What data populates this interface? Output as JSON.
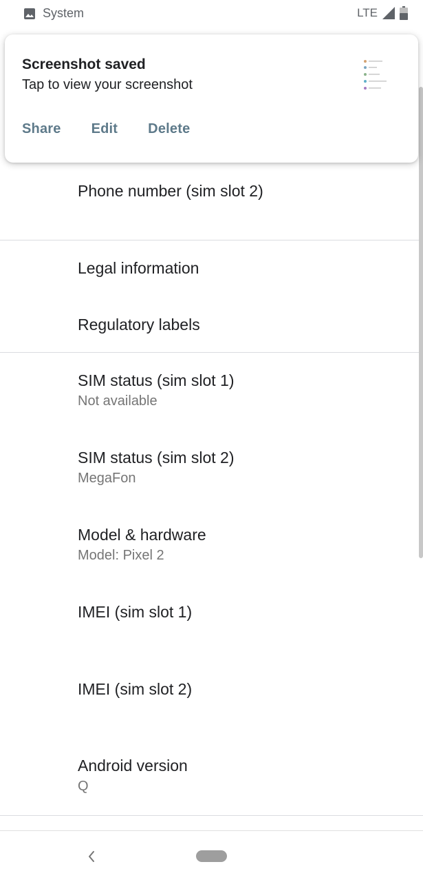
{
  "status_bar": {
    "app_name": "System",
    "network": "LTE",
    "notification_icon": "image-icon",
    "signal_icon": "signal-icon",
    "battery_icon": "battery-icon"
  },
  "notification": {
    "title": "Screenshot saved",
    "text": "Tap to view your screenshot",
    "actions": [
      "Share",
      "Edit",
      "Delete"
    ],
    "action_color": "#5e7a8a"
  },
  "settings": {
    "items": [
      {
        "title": "Phone number (sim slot 2)",
        "summary": ""
      },
      {
        "title": "Legal information",
        "summary": ""
      },
      {
        "title": "Regulatory labels",
        "summary": ""
      },
      {
        "title": "SIM status (sim slot 1)",
        "summary": "Not available"
      },
      {
        "title": "SIM status (sim slot 2)",
        "summary": "MegaFon"
      },
      {
        "title": "Model & hardware",
        "summary": "Model: Pixel 2"
      },
      {
        "title": "IMEI (sim slot 1)",
        "summary": ""
      },
      {
        "title": "IMEI (sim slot 2)",
        "summary": ""
      },
      {
        "title": "Android version",
        "summary": "Q"
      }
    ]
  },
  "nav": {
    "back_icon": "back-chevron-icon",
    "home_icon": "home-pill-icon"
  }
}
